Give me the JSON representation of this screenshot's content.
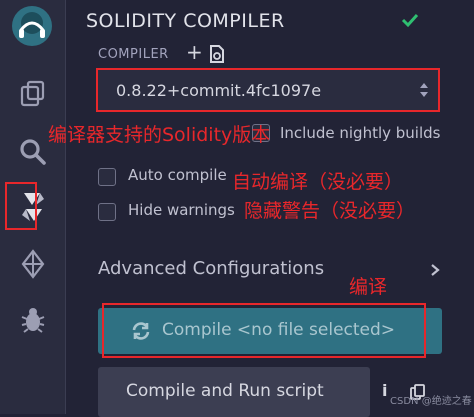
{
  "panel": {
    "title": "SOLIDITY COMPILER",
    "compiler_label": "COMPILER",
    "compiler_version": "0.8.22+commit.4fc1097e",
    "include_nightly": "Include nightly builds",
    "auto_compile": "Auto compile",
    "hide_warnings": "Hide warnings",
    "advanced": "Advanced Configurations",
    "compile_button": "Compile <no file selected>",
    "run_button": "Compile and Run script",
    "info_glyph": "i"
  },
  "annotations": {
    "versions": "编译器支持的Solidity版本",
    "auto_compile": "自动编译（没必要）",
    "hide_warnings": "隐藏警告（没必要）",
    "compile": "编译"
  },
  "watermark": "CSDN @绝迹之春",
  "colors": {
    "accent_teal": "#2f7183",
    "annotation_red": "#e8272b",
    "check_green": "#2fbf71"
  },
  "icons": [
    "remix-logo-icon",
    "file-explorer-icon",
    "search-icon",
    "solidity-compiler-icon",
    "deploy-icon",
    "debugger-icon",
    "check-icon",
    "plus-icon",
    "file-add-icon",
    "select-arrows-icon",
    "chevron-right-icon",
    "refresh-icon",
    "info-icon",
    "copy-icon"
  ]
}
